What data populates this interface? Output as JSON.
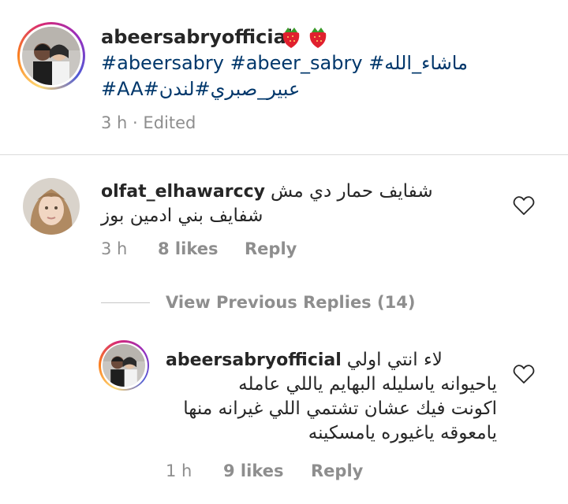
{
  "post": {
    "username": "abeersabryofficial",
    "emoji": "🍓🍓",
    "line2": "#abeersabry #abeer_sabry #ماشاء_الله",
    "line3": "#AA#عبير_صبري#لندن",
    "time": "3 h",
    "edited": "Edited",
    "separator": "·"
  },
  "comment1": {
    "username": "olfat_elhawarccy",
    "text_line1": "شفايف حمار دي مش",
    "text_line2": "شفايف بني ادمين بوز",
    "time": "3 h",
    "likes": "8 likes",
    "reply": "Reply"
  },
  "view_previous": "View Previous Replies (14)",
  "reply1": {
    "username": "abeersabryofficial",
    "text_line1": "لاء انتي اولي",
    "text_line2": "ياحيوانه ياسليله البهايم ياللي عامله",
    "text_line3": "اكونت فيك عشان تشتمي اللي غيرانه منها",
    "text_line4": "يامعوقه ياغيوره يامسكينه",
    "time": "1 h",
    "likes": "9 likes",
    "reply": "Reply"
  },
  "colors": {
    "hashtag": "#00376b",
    "meta": "#8e8e8e",
    "divider": "#dbdbdb",
    "text": "#262626"
  },
  "icons": [
    "heart-outline-icon"
  ]
}
